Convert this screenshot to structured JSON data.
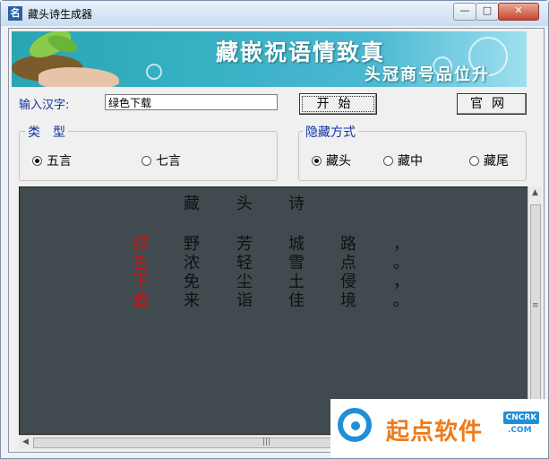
{
  "window": {
    "title": "藏头诗生成器",
    "icon_char": "名",
    "min_glyph": "—",
    "max_glyph": "□",
    "close_glyph": "✕"
  },
  "banner": {
    "slogan_main": "藏嵌祝语情致真",
    "slogan_sub": "头冠商号品位升"
  },
  "input": {
    "label": "输入汉字:",
    "value": "绿色下载"
  },
  "buttons": {
    "start": "开始",
    "website": "官网"
  },
  "type_group": {
    "legend": "类　型",
    "options": [
      "五言",
      "七言"
    ],
    "selected": "五言"
  },
  "mode_group": {
    "legend": "隐藏方式",
    "options": [
      "藏头",
      "藏中",
      "藏尾"
    ],
    "selected": "藏头"
  },
  "poem": {
    "title_chars": [
      "藏",
      "头",
      "诗"
    ],
    "lines": [
      {
        "head": "绿",
        "chars": [
          "野",
          "芳",
          "城",
          "路",
          "，"
        ]
      },
      {
        "head": "色",
        "chars": [
          "浓",
          "轻",
          "雪",
          "点",
          "。"
        ]
      },
      {
        "head": "下",
        "chars": [
          "免",
          "尘",
          "土",
          "侵",
          "，"
        ]
      },
      {
        "head": "载",
        "chars": [
          "来",
          "诣",
          "佳",
          "境",
          "。"
        ]
      }
    ]
  },
  "scrollbars": {
    "up": "▲",
    "down": "▼",
    "left": "◀",
    "right": "▶",
    "grip": "≡",
    "hgrip": "|||"
  },
  "watermark": {
    "brand_text": "起点软件",
    "badge": "CNCRK",
    "domain": ".COM"
  },
  "colors": {
    "label_blue": "#1233a0",
    "output_bg": "#414a4e",
    "head_red": "#cc1111"
  }
}
